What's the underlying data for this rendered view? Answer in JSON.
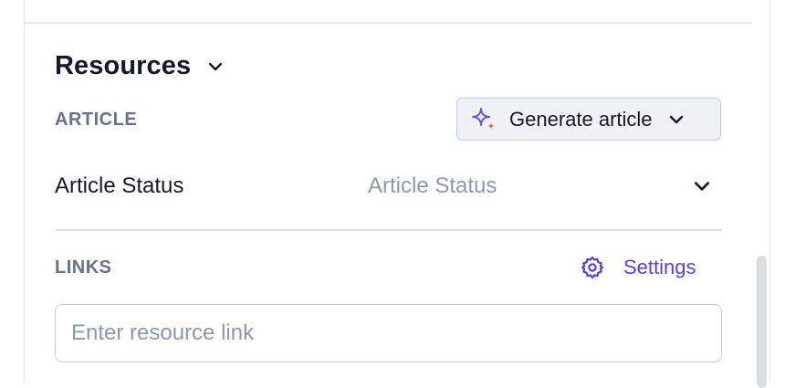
{
  "section": {
    "title": "Resources"
  },
  "article": {
    "label": "ARTICLE",
    "generate_button_label": "Generate article",
    "status_label": "Article Status",
    "status_placeholder": "Article Status"
  },
  "links": {
    "label": "LINKS",
    "settings_label": "Settings",
    "input_placeholder": "Enter resource link",
    "input_value": ""
  },
  "icons": {
    "collapse": "chevron-down-icon",
    "generate": "sparkle-icon",
    "generate_dropdown": "chevron-down-icon",
    "status_dropdown": "chevron-down-icon",
    "settings": "gear-icon"
  },
  "colors": {
    "accent": "#5b3fd6",
    "sparkle_primary": "#6f56e0",
    "sparkle_secondary": "#e0556a",
    "muted_label": "#66738a",
    "placeholder": "#8d99ab"
  }
}
